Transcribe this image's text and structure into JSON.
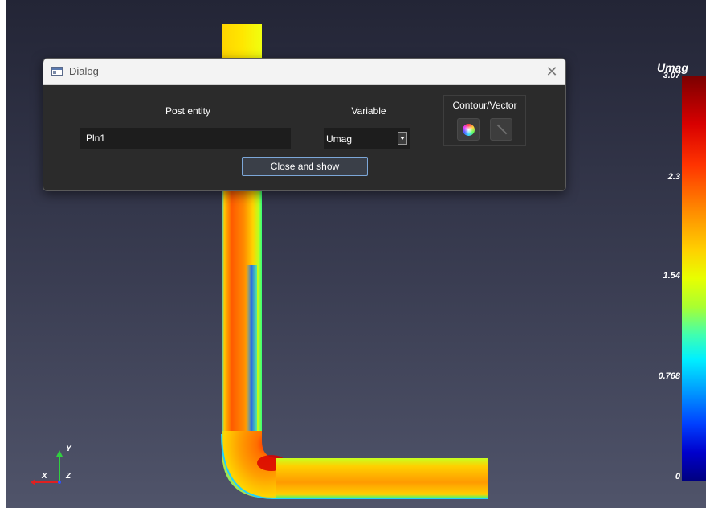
{
  "dialog": {
    "title": "Dialog",
    "close_glyph": "✕",
    "post_entity_label": "Post entity",
    "post_entity_value": "Pln1",
    "variable_label": "Variable",
    "variable_value": "Umag",
    "contour_vector_label": "Contour/Vector",
    "contour_icon": "color-wheel-icon",
    "vector_icon": "vector-line-icon",
    "close_show_label": "Close and show"
  },
  "legend": {
    "title": "Umag",
    "ticks": [
      "3.07",
      "2.3",
      "1.54",
      "0.768",
      "0"
    ]
  },
  "axes": {
    "x": "X",
    "y": "Y",
    "z": "Z"
  },
  "colors": {
    "background_top": "#232536",
    "background_bottom": "#50546a",
    "accent_border": "#7ca7d8"
  }
}
